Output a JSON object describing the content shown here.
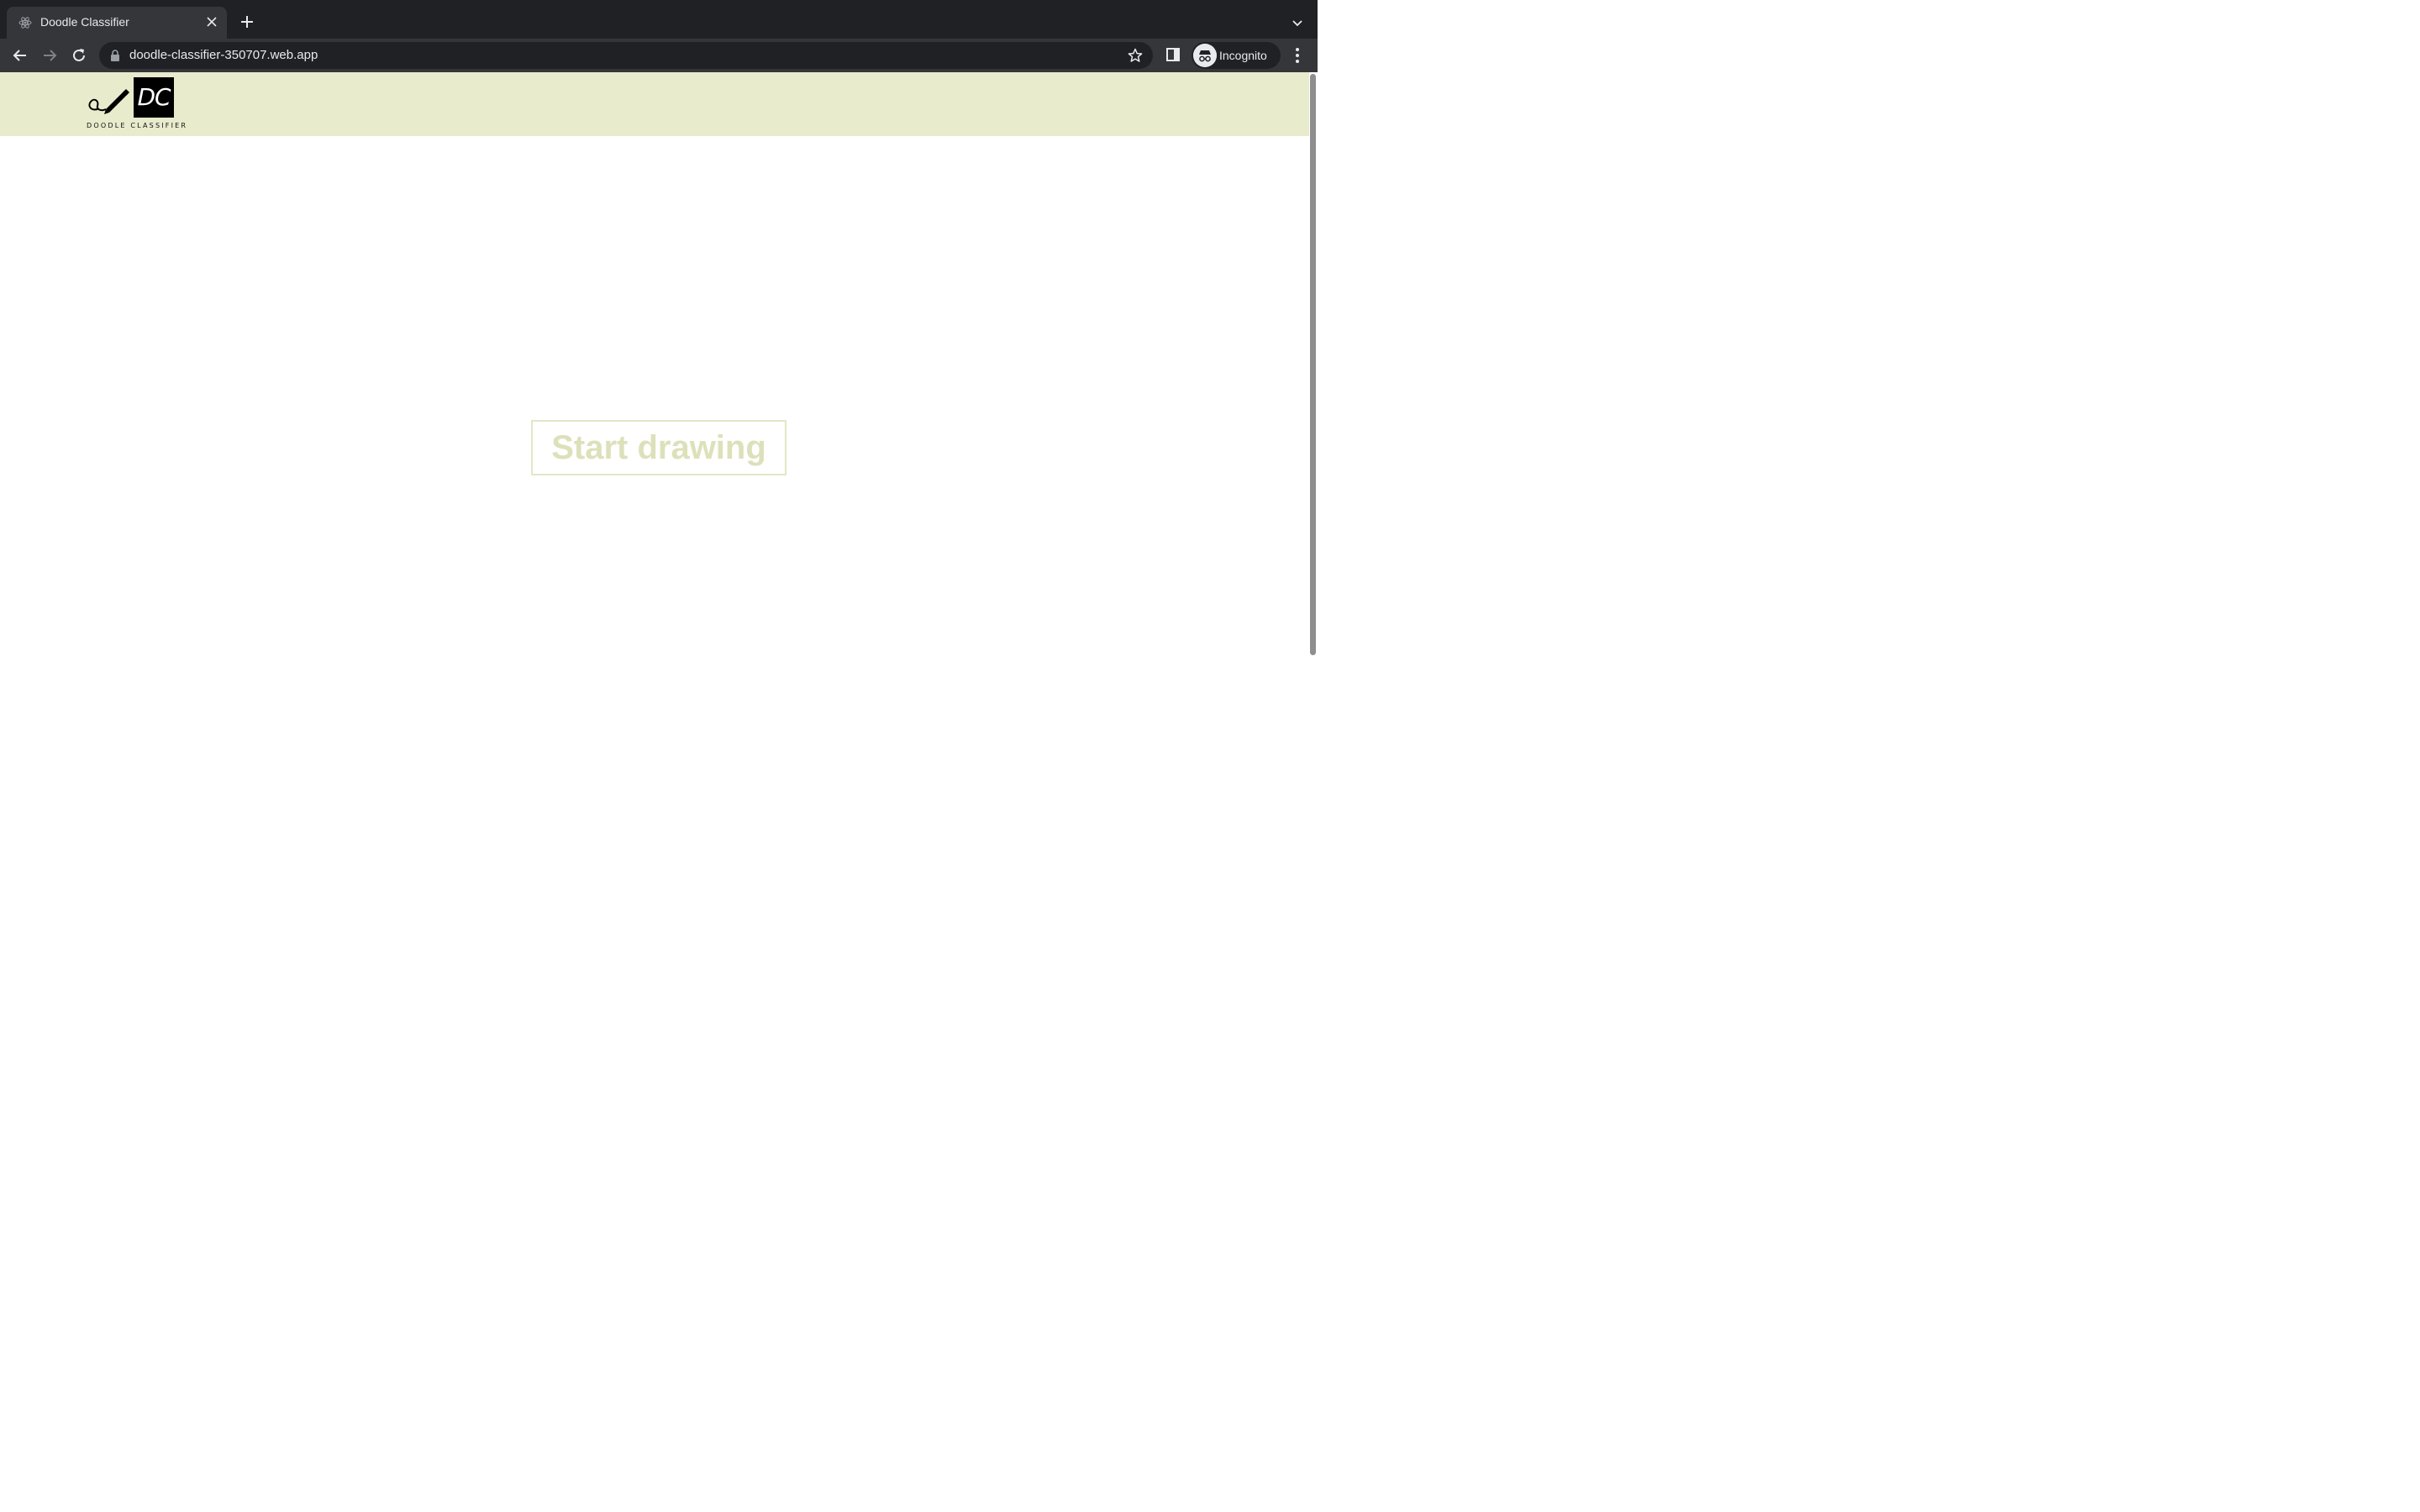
{
  "browser": {
    "tab_title": "Doodle Classifier",
    "url": "doodle-classifier-350707.web.app",
    "profile_label": "Incognito"
  },
  "app": {
    "logo_mark": "DC",
    "logo_caption": "DOODLE CLASSIFIER",
    "start_button_label": "Start drawing"
  },
  "colors": {
    "header_bg": "#e8ebcc",
    "start_text": "#dde1ba",
    "chrome_dark": "#202124",
    "chrome_toolbar": "#35363a"
  },
  "icons": [
    "react-favicon-icon",
    "close-icon",
    "plus-icon",
    "chevron-down-icon",
    "back-arrow-icon",
    "forward-arrow-icon",
    "reload-icon",
    "lock-icon",
    "star-icon",
    "side-panel-icon",
    "incognito-icon",
    "kebab-menu-icon",
    "pen-icon"
  ]
}
